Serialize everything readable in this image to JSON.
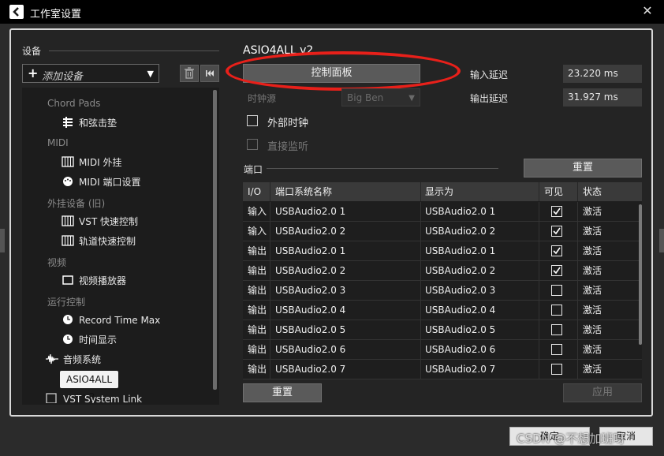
{
  "window": {
    "title": "工作室设置",
    "close_glyph": "✕"
  },
  "left": {
    "devices_label": "设备",
    "add_device": {
      "plus": "+",
      "label": "添加设备",
      "arrow": "▼"
    },
    "tree": [
      {
        "type": "group",
        "label": "Chord Pads"
      },
      {
        "type": "item",
        "label": "和弦击垫",
        "icon": "sliders-icon"
      },
      {
        "type": "group",
        "label": "MIDI"
      },
      {
        "type": "item",
        "label": "MIDI 外挂",
        "icon": "keyboard-icon"
      },
      {
        "type": "item",
        "label": "MIDI 端口设置",
        "icon": "midi-port-icon"
      },
      {
        "type": "group",
        "label": "外挂设备 (旧)"
      },
      {
        "type": "item",
        "label": "VST 快速控制",
        "icon": "keyboard-icon"
      },
      {
        "type": "item",
        "label": "轨道快速控制",
        "icon": "keyboard-icon"
      },
      {
        "type": "group",
        "label": "视频"
      },
      {
        "type": "item",
        "label": "视频播放器",
        "icon": "video-icon"
      },
      {
        "type": "group",
        "label": "运行控制"
      },
      {
        "type": "item",
        "label": "Record Time Max",
        "icon": "clock-icon"
      },
      {
        "type": "item",
        "label": "时间显示",
        "icon": "clock-icon"
      },
      {
        "type": "item",
        "label": "音频系统",
        "icon": "waveform-icon"
      },
      {
        "type": "selected",
        "label": "ASIO4ALL v2"
      },
      {
        "type": "item",
        "label": "VST System Link",
        "icon": "checkbox-icon"
      }
    ]
  },
  "right": {
    "title": "ASIO4ALL v2",
    "control_panel": "控制面板",
    "clock_source_label": "时钟源",
    "clock_source_value": "Big Ben",
    "external_clock": "外部时钟",
    "direct_monitor": "直接监听",
    "input_latency_label": "输入延迟",
    "input_latency": "23.220 ms",
    "output_latency_label": "输出延迟",
    "output_latency": "31.927 ms",
    "ports_label": "端口",
    "reset_label": "重置",
    "columns": [
      "I/O",
      "端口系统名称",
      "显示为",
      "可见",
      "状态"
    ],
    "rows": [
      {
        "io": "输入",
        "name": "USBAudio2.0 1",
        "display": "USBAudio2.0 1",
        "visible": true,
        "status": "激活"
      },
      {
        "io": "输入",
        "name": "USBAudio2.0 2",
        "display": "USBAudio2.0 2",
        "visible": true,
        "status": "激活"
      },
      {
        "io": "输出",
        "name": "USBAudio2.0 1",
        "display": "USBAudio2.0 1",
        "visible": true,
        "status": "激活"
      },
      {
        "io": "输出",
        "name": "USBAudio2.0 2",
        "display": "USBAudio2.0 2",
        "visible": true,
        "status": "激活"
      },
      {
        "io": "输出",
        "name": "USBAudio2.0 3",
        "display": "USBAudio2.0 3",
        "visible": false,
        "status": "激活"
      },
      {
        "io": "输出",
        "name": "USBAudio2.0 4",
        "display": "USBAudio2.0 4",
        "visible": false,
        "status": "激活"
      },
      {
        "io": "输出",
        "name": "USBAudio2.0 5",
        "display": "USBAudio2.0 5",
        "visible": false,
        "status": "激活"
      },
      {
        "io": "输出",
        "name": "USBAudio2.0 6",
        "display": "USBAudio2.0 6",
        "visible": false,
        "status": "激活"
      },
      {
        "io": "输出",
        "name": "USBAudio2.0 7",
        "display": "USBAudio2.0 7",
        "visible": false,
        "status": "激活"
      }
    ],
    "reset_bottom": "重置",
    "apply": "应用"
  },
  "footer": {
    "ok": "确定",
    "cancel": "取消",
    "watermark": "CSDN @不想加班呀"
  }
}
